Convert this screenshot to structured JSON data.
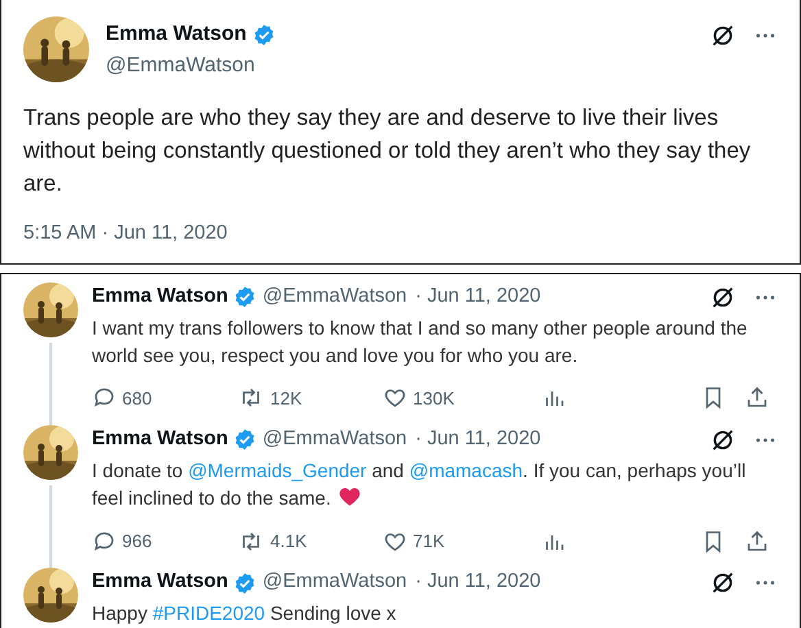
{
  "main_tweet": {
    "name": "Emma Watson",
    "verified": true,
    "handle": "@EmmaWatson",
    "text": "Trans people are who they say they are and deserve to live their lives without being constantly questioned or told they aren’t who they say they are.",
    "timestamp": "5:15 AM · Jun 11, 2020"
  },
  "thread": [
    {
      "name": "Emma Watson",
      "verified": true,
      "handle": "@EmmaWatson",
      "date": "· Jun 11, 2020",
      "body": [
        {
          "kind": "text",
          "text": "I want my trans followers to know that I and so many other people around the world see you, respect you and love you for who you are."
        }
      ],
      "stats": {
        "replies": "680",
        "reposts": "12K",
        "likes": "130K"
      },
      "thread_line": true
    },
    {
      "name": "Emma Watson",
      "verified": true,
      "handle": "@EmmaWatson",
      "date": "· Jun 11, 2020",
      "body": [
        {
          "kind": "text",
          "text": "I donate to "
        },
        {
          "kind": "link",
          "text": "@Mermaids_Gender"
        },
        {
          "kind": "text",
          "text": " and "
        },
        {
          "kind": "link",
          "text": "@mamacash"
        },
        {
          "kind": "text",
          "text": ". If you can, perhaps you’ll feel inclined to do the same. "
        },
        {
          "kind": "heart"
        }
      ],
      "stats": {
        "replies": "966",
        "reposts": "4.1K",
        "likes": "71K"
      },
      "thread_line": true
    },
    {
      "name": "Emma Watson",
      "verified": true,
      "handle": "@EmmaWatson",
      "date": "· Jun 11, 2020",
      "body": [
        {
          "kind": "text",
          "text": "Happy "
        },
        {
          "kind": "link",
          "text": "#PRIDE2020"
        },
        {
          "kind": "text",
          "text": " Sending love x"
        }
      ],
      "thread_line": false
    }
  ]
}
